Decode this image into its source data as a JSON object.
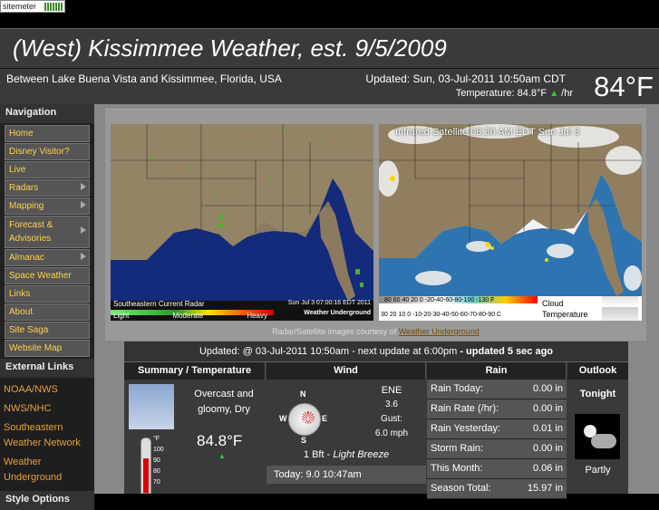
{
  "sitemeter": {
    "label": "sitemeter"
  },
  "header": {
    "title": "(West) Kissimmee Weather, est. 9/5/2009",
    "location": "Between Lake Buena Vista and Kissimmee, Florida, USA",
    "updated": "Updated:  Sun, 03-Jul-2011 10:50am CDT",
    "temperature_line": "Temperature: 84.8°F",
    "temperature_rate": "/hr",
    "big_temp": "84°F"
  },
  "sidebar": {
    "nav_heading": "Navigation",
    "nav_items": [
      {
        "label": "Home"
      },
      {
        "label": "Disney Visitor?"
      },
      {
        "label": "Live"
      },
      {
        "label": "Radars"
      },
      {
        "label": "Mapping"
      },
      {
        "label": "Forecast & Advisories"
      },
      {
        "label": "Almanac"
      },
      {
        "label": "Space Weather"
      },
      {
        "label": "Links"
      },
      {
        "label": "About"
      },
      {
        "label": "Site Saga"
      },
      {
        "label": "Website Map"
      }
    ],
    "ext_heading": "External Links",
    "ext_links": [
      "NOAA/NWS",
      "NWS/NHC",
      "Southeastern Weather Network",
      "Weather Underground"
    ],
    "style_heading": "Style Options"
  },
  "maps": {
    "radar_caption": "Southeastern Current Radar",
    "radar_time": "Sun Jul 3 07:00:16 EDT 2011",
    "radar_scale": [
      "Light",
      "Moderate",
      "Heavy"
    ],
    "sat_caption": "Infrared Satellite 08:30 AM EDT Sun Jul 3",
    "sat_scale_top": "80 60 40 20  0 -20-40-60-80-100 -130 F",
    "sat_scale_bottom": "30 20 10  0 -10-20-30-40-50-60-70-80-90 C",
    "sat_legend_1": "Cloud",
    "sat_legend_2": "Temperature",
    "wu_logo": "Weather Underground",
    "courtesy": "Radar/Satellite images courtesy of",
    "courtesy_link": "Weather Underground"
  },
  "conditions": {
    "update_text": "Updated: @ 03-Jul-2011 10:50am - next update at 6:00pm",
    "updated_ago": "- updated 5 sec ago",
    "col_summary": "Summary / Temperature",
    "col_wind": "Wind",
    "col_rain": "Rain",
    "col_outlook": "Outlook",
    "summary_text": "Overcast and gloomy, Dry",
    "temp": "84.8°F",
    "thermo_scale": [
      "°F",
      "100",
      "90",
      "80",
      "70"
    ],
    "wind_dir": "ENE",
    "wind_speed": "3.6",
    "gust_label": "Gust:",
    "gust_value": "6.0 mph",
    "compass": [
      "N",
      "W",
      "E",
      "S"
    ],
    "beaufort": "1 Bft -",
    "beaufort_desc": "Light Breeze",
    "wind_today": "Today: 9.0 10:47am",
    "rain": [
      {
        "label": "Rain Today:",
        "value": "0.00 in"
      },
      {
        "label": "Rain Rate (/hr):",
        "value": "0.00 in"
      },
      {
        "label": "Rain Yesterday:",
        "value": "0.01 in"
      },
      {
        "label": "Storm Rain:",
        "value": "0.00 in"
      },
      {
        "label": "This Month:",
        "value": "0.06 in"
      },
      {
        "label": "Season Total:",
        "value": "15.97 in"
      }
    ],
    "outlook_title": "Tonight",
    "outlook_text": "Partly"
  }
}
